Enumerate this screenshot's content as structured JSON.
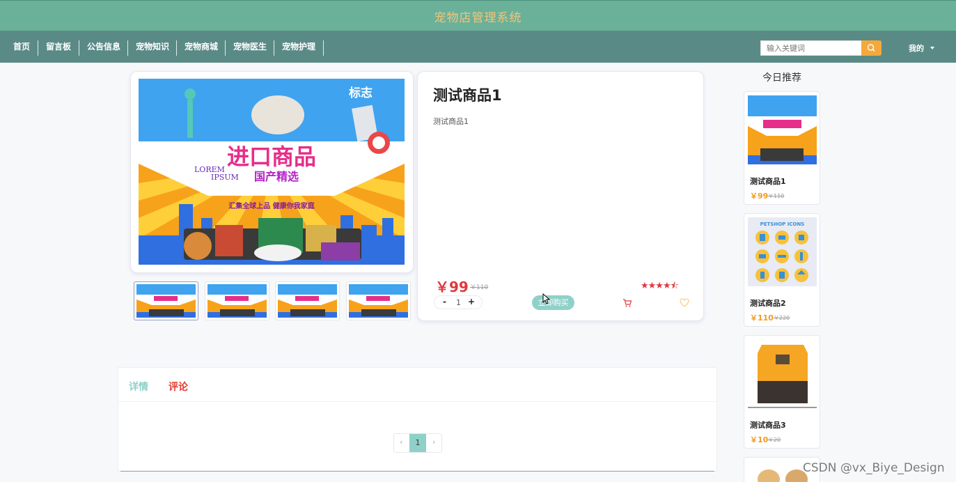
{
  "app": {
    "title": "宠物店管理系统"
  },
  "nav": {
    "items": [
      {
        "label": "首页"
      },
      {
        "label": "留言板"
      },
      {
        "label": "公告信息"
      },
      {
        "label": "宠物知识"
      },
      {
        "label": "宠物商城"
      },
      {
        "label": "宠物医生"
      },
      {
        "label": "宠物护理"
      }
    ],
    "search_placeholder": "输入关键词",
    "user_menu": "我的"
  },
  "product": {
    "name": "测试商品1",
    "description": "测试商品1",
    "price": "￥99",
    "original_price": "￥110",
    "rating_stars": 4.5,
    "rating_text": "★★★★⯪",
    "quantity": "1",
    "minus": "-",
    "plus": "+",
    "buy_label": "立即购买",
    "banner": {
      "brand": "标志",
      "headline": "进口商品",
      "subline": "国产精选",
      "lorem1": "LOREM",
      "lorem2": "IPSUM",
      "slogan": "汇集全球上品   健康你我家庭"
    }
  },
  "recommend": {
    "title": "今日推荐",
    "items": [
      {
        "name": "测试商品1",
        "price": "￥99",
        "old_price": "￥110"
      },
      {
        "name": "测试商品2",
        "price": "￥110",
        "old_price": "￥220",
        "image_text": "PETSHOP ICONS"
      },
      {
        "name": "测试商品3",
        "price": "￥10",
        "old_price": "￥20"
      }
    ]
  },
  "tabs": [
    {
      "label": "详情",
      "color": "#8fd1c8"
    },
    {
      "label": "评论",
      "color": "#e03c31"
    }
  ],
  "pagination": {
    "prev": "‹",
    "current": "1",
    "next": "›"
  },
  "watermark": "CSDN @vx_Biye_Design",
  "colors": {
    "topbar": "#6bb19a",
    "navbar": "#5a8a86",
    "accent": "#8fd1c8",
    "price": "#e0383e",
    "title_gold": "#f3c47a"
  }
}
